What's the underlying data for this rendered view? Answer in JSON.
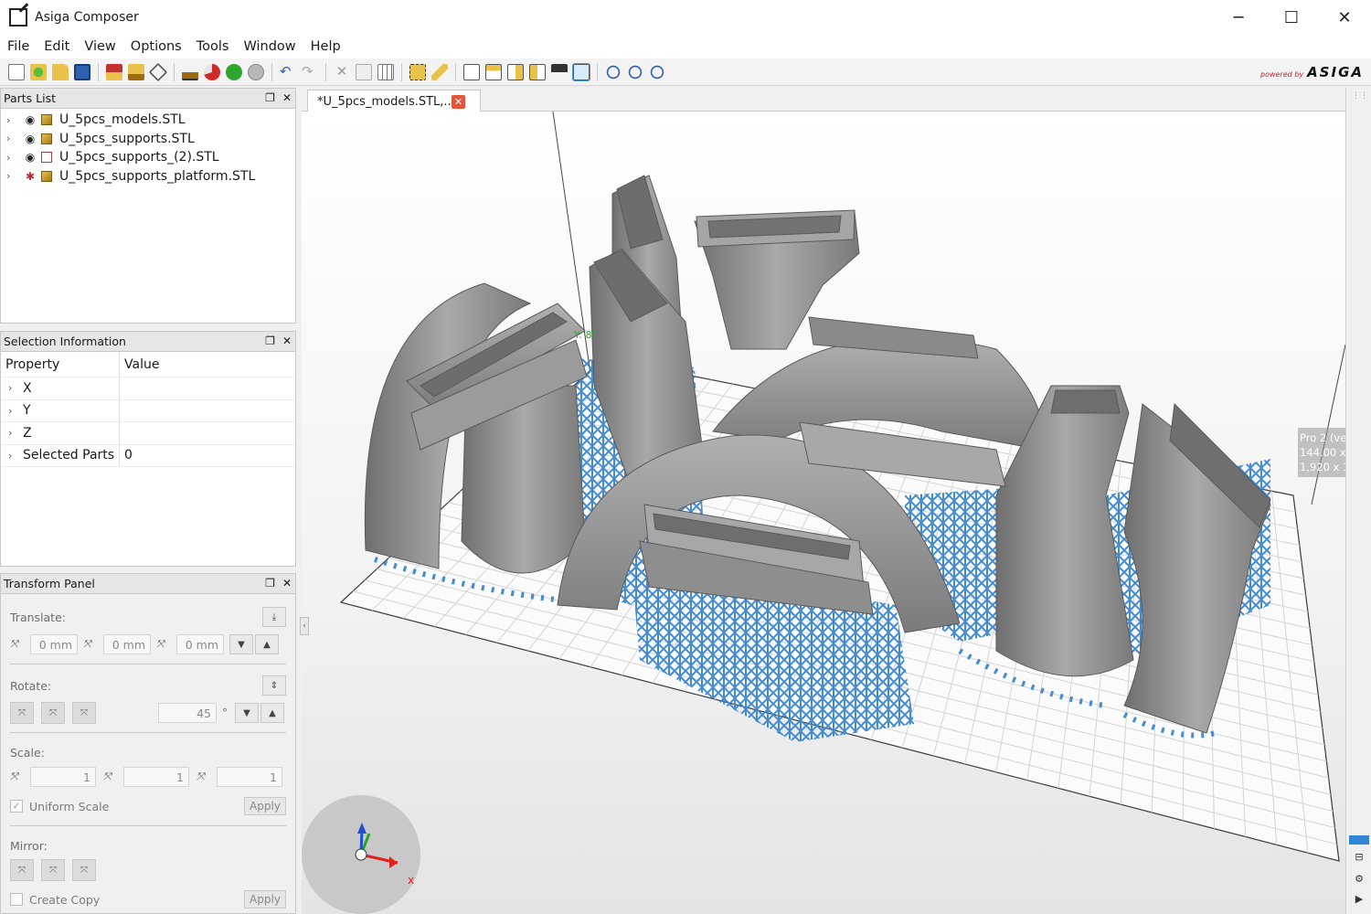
{
  "window": {
    "title": "Asiga Composer",
    "controls": {
      "minimize": "─",
      "maximize": "☐",
      "close": "✕"
    }
  },
  "menu": [
    "File",
    "Edit",
    "View",
    "Options",
    "Tools",
    "Window",
    "Help"
  ],
  "brand": {
    "powered": "powered by",
    "name": "ASIGA"
  },
  "parts_list": {
    "title": "Parts List",
    "items": [
      {
        "name": "U_5pcs_models.STL",
        "visible": true,
        "icon": "cube-icon"
      },
      {
        "name": "U_5pcs_supports.STL",
        "visible": true,
        "icon": "cube-icon"
      },
      {
        "name": "U_5pcs_supports_(2).STL",
        "visible": true,
        "icon": "support-icon"
      },
      {
        "name": "U_5pcs_supports_platform.STL",
        "visible": false,
        "icon": "cube-icon"
      }
    ]
  },
  "selection_info": {
    "title": "Selection Information",
    "col_property": "Property",
    "col_value": "Value",
    "rows": [
      {
        "property": "X",
        "value": ""
      },
      {
        "property": "Y",
        "value": ""
      },
      {
        "property": "Z",
        "value": ""
      },
      {
        "property": "Selected Parts",
        "value": "0"
      }
    ]
  },
  "transform": {
    "title": "Transform Panel",
    "translate_label": "Translate:",
    "translate": {
      "x": "0 mm",
      "y": "0 mm",
      "z": "0 mm"
    },
    "rotate_label": "Rotate:",
    "rotate_value": "45",
    "rotate_unit": "°",
    "scale_label": "Scale:",
    "scale": {
      "x": "1",
      "y": "1",
      "z": "1"
    },
    "uniform_scale_label": "Uniform Scale",
    "uniform_scale_checked": true,
    "apply_label": "Apply",
    "mirror_label": "Mirror:",
    "create_copy_label": "Create Copy",
    "create_copy_checked": false,
    "apply2_label": "Apply",
    "axis": {
      "x": "X",
      "y": "Y",
      "z": "Z"
    }
  },
  "document_tab": {
    "label": "*U_5pcs_models.STL,...",
    "close": "✕"
  },
  "viewport": {
    "y_label": "Y: 81",
    "printer_info": [
      "Pro 2 (ve",
      "144.00 x",
      "1,920 x 1"
    ],
    "gizmo_x": "x",
    "colors": {
      "model": "#8f8f8f",
      "support": "#3b87cf",
      "grid": "#d4d4d4",
      "axis_x": "#e02020",
      "axis_y": "#22a522",
      "axis_z": "#2050d0"
    }
  }
}
